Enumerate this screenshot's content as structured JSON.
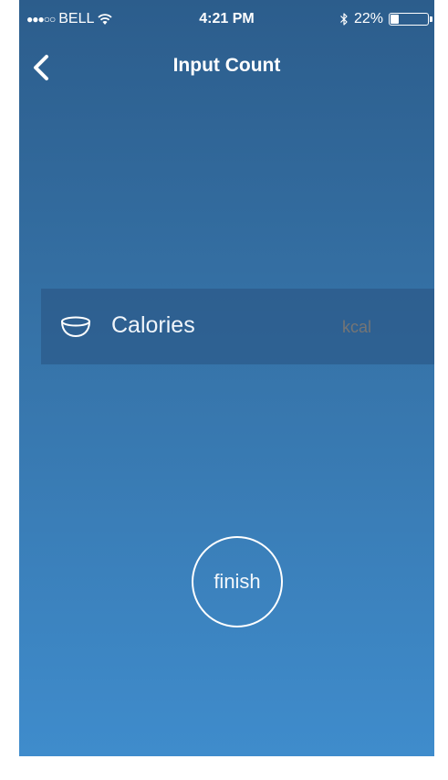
{
  "status_bar": {
    "signal": "●●●○○",
    "carrier": "BELL",
    "time": "4:21 PM",
    "battery_percent_text": "22%",
    "battery_level": 0.22
  },
  "nav": {
    "title": "Input Count"
  },
  "calorie_row": {
    "label": "Calories",
    "unit_placeholder": "kcal"
  },
  "finish_button": {
    "label": "finish"
  },
  "icons": {
    "back": "chevron-left-icon",
    "bowl": "bowl-icon",
    "wifi": "wifi-icon",
    "bluetooth": "bluetooth-icon"
  }
}
